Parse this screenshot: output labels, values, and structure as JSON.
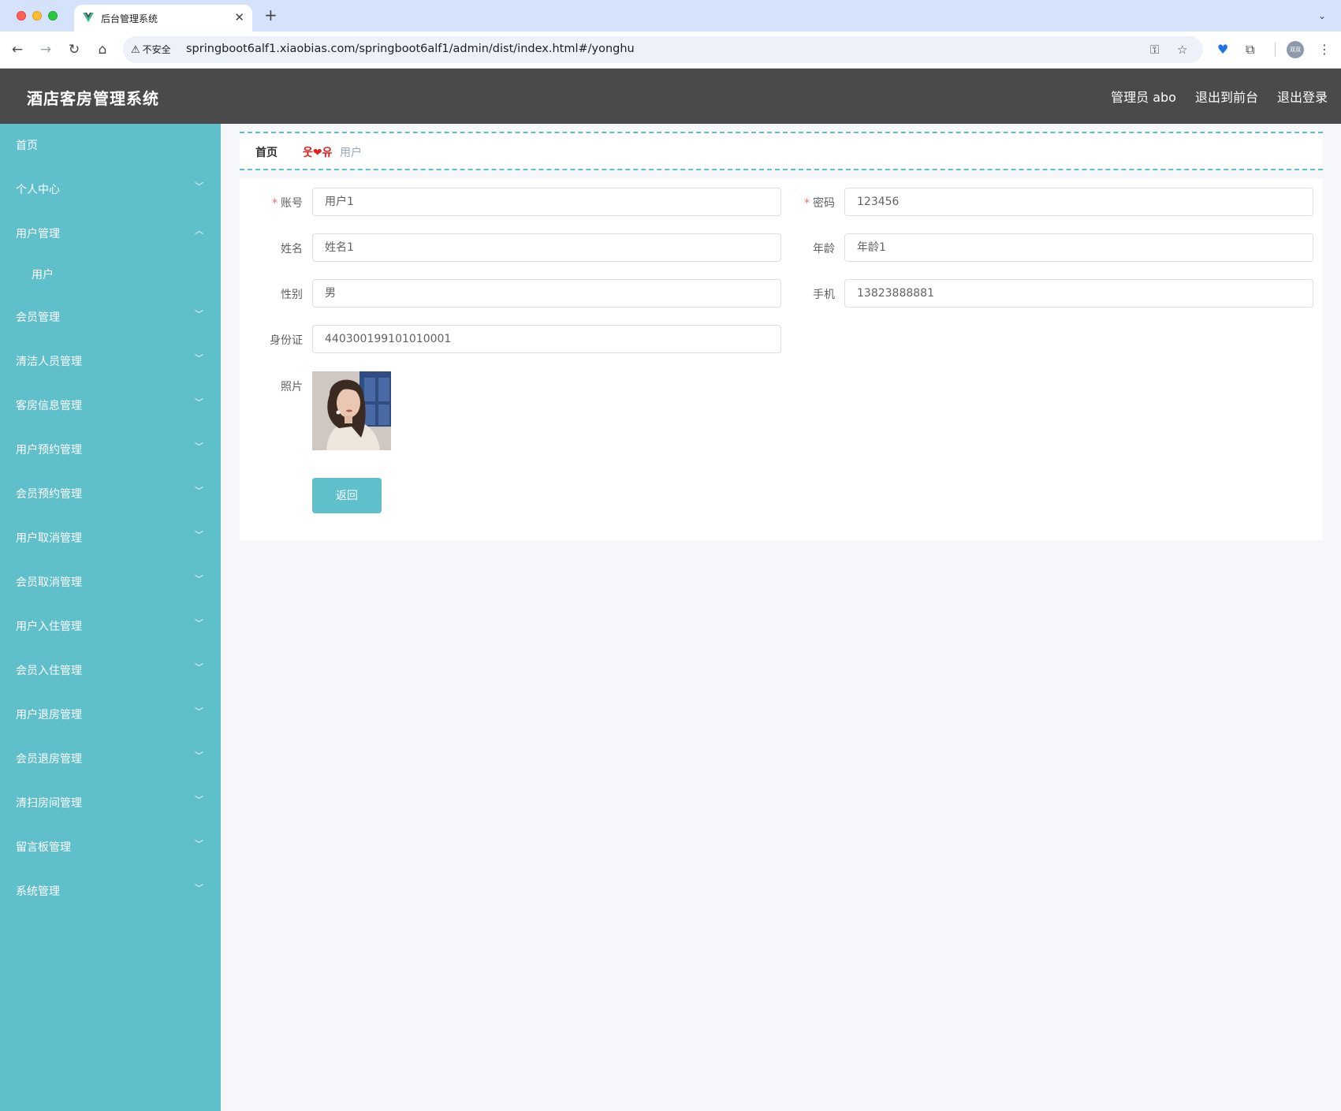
{
  "browser": {
    "tab_title": "后台管理系统",
    "security_label": "不安全",
    "url": "springboot6alf1.xiaobias.com/springboot6alf1/admin/dist/index.html#/yonghu",
    "profile_initials": "双双"
  },
  "header": {
    "title": "酒店客房管理系统",
    "admin_label": "管理员 abo",
    "front_link": "退出到前台",
    "logout_link": "退出登录"
  },
  "sidebar": {
    "items": [
      {
        "label": "首页",
        "has_arrow": false
      },
      {
        "label": "个人中心",
        "has_arrow": true
      },
      {
        "label": "用户管理",
        "has_arrow": true,
        "expanded": true
      },
      {
        "label": "用户",
        "sub": true
      },
      {
        "label": "会员管理",
        "has_arrow": true
      },
      {
        "label": "清洁人员管理",
        "has_arrow": true
      },
      {
        "label": "客房信息管理",
        "has_arrow": true
      },
      {
        "label": "用户预约管理",
        "has_arrow": true
      },
      {
        "label": "会员预约管理",
        "has_arrow": true
      },
      {
        "label": "用户取消管理",
        "has_arrow": true
      },
      {
        "label": "会员取消管理",
        "has_arrow": true
      },
      {
        "label": "用户入住管理",
        "has_arrow": true
      },
      {
        "label": "会员入住管理",
        "has_arrow": true
      },
      {
        "label": "用户退房管理",
        "has_arrow": true
      },
      {
        "label": "会员退房管理",
        "has_arrow": true
      },
      {
        "label": "清扫房间管理",
        "has_arrow": true
      },
      {
        "label": "留言板管理",
        "has_arrow": true
      },
      {
        "label": "系统管理",
        "has_arrow": true
      }
    ]
  },
  "breadcrumb": {
    "home": "首页",
    "separator": "웃❤유",
    "current": "用户"
  },
  "form": {
    "account_label": "账号",
    "account_value": "用户1",
    "password_label": "密码",
    "password_value": "123456",
    "name_label": "姓名",
    "name_value": "姓名1",
    "age_label": "年龄",
    "age_value": "年龄1",
    "gender_label": "性别",
    "gender_value": "男",
    "phone_label": "手机",
    "phone_value": "13823888881",
    "idcard_label": "身份证",
    "idcard_value": "440300199101010001",
    "photo_label": "照片",
    "back_button": "返回",
    "required_mark": "*"
  },
  "colors": {
    "accent": "#5fbfcb",
    "header_bg": "#4a4a4a",
    "required": "#f56c6c",
    "breadcrumb_sep": "#e02020"
  }
}
